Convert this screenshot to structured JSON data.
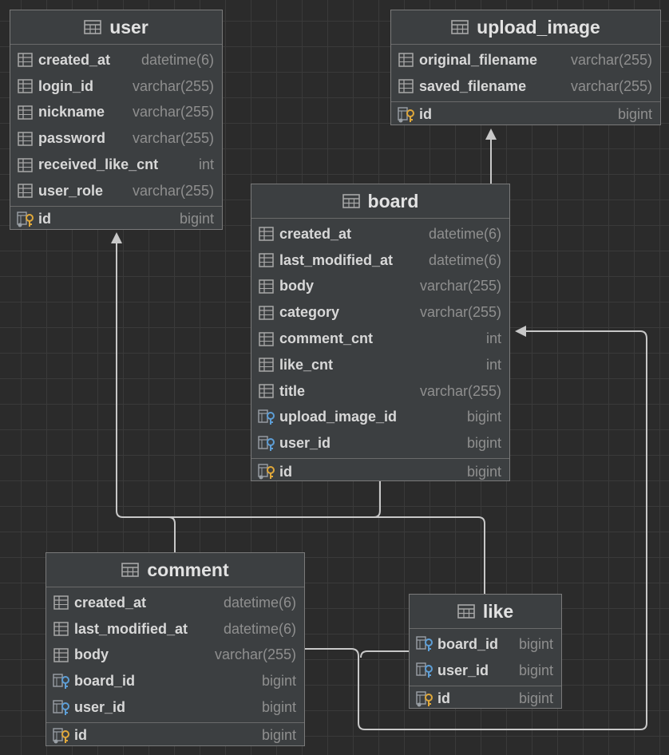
{
  "tables": {
    "user": {
      "name": "user",
      "columns": [
        {
          "name": "created_at",
          "type": "datetime(6)",
          "kind": "column"
        },
        {
          "name": "login_id",
          "type": "varchar(255)",
          "kind": "column"
        },
        {
          "name": "nickname",
          "type": "varchar(255)",
          "kind": "column"
        },
        {
          "name": "password",
          "type": "varchar(255)",
          "kind": "column"
        },
        {
          "name": "received_like_cnt",
          "type": "int",
          "kind": "column"
        },
        {
          "name": "user_role",
          "type": "varchar(255)",
          "kind": "column"
        }
      ],
      "pk": {
        "name": "id",
        "type": "bigint"
      }
    },
    "upload_image": {
      "name": "upload_image",
      "columns": [
        {
          "name": "original_filename",
          "type": "varchar(255)",
          "kind": "column"
        },
        {
          "name": "saved_filename",
          "type": "varchar(255)",
          "kind": "column"
        }
      ],
      "pk": {
        "name": "id",
        "type": "bigint"
      }
    },
    "board": {
      "name": "board",
      "columns": [
        {
          "name": "created_at",
          "type": "datetime(6)",
          "kind": "column"
        },
        {
          "name": "last_modified_at",
          "type": "datetime(6)",
          "kind": "column"
        },
        {
          "name": "body",
          "type": "varchar(255)",
          "kind": "column"
        },
        {
          "name": "category",
          "type": "varchar(255)",
          "kind": "column"
        },
        {
          "name": "comment_cnt",
          "type": "int",
          "kind": "column"
        },
        {
          "name": "like_cnt",
          "type": "int",
          "kind": "column"
        },
        {
          "name": "title",
          "type": "varchar(255)",
          "kind": "column"
        },
        {
          "name": "upload_image_id",
          "type": "bigint",
          "kind": "fk"
        },
        {
          "name": "user_id",
          "type": "bigint",
          "kind": "fk"
        }
      ],
      "pk": {
        "name": "id",
        "type": "bigint"
      }
    },
    "comment": {
      "name": "comment",
      "columns": [
        {
          "name": "created_at",
          "type": "datetime(6)",
          "kind": "column"
        },
        {
          "name": "last_modified_at",
          "type": "datetime(6)",
          "kind": "column"
        },
        {
          "name": "body",
          "type": "varchar(255)",
          "kind": "column"
        },
        {
          "name": "board_id",
          "type": "bigint",
          "kind": "fk"
        },
        {
          "name": "user_id",
          "type": "bigint",
          "kind": "fk"
        }
      ],
      "pk": {
        "name": "id",
        "type": "bigint"
      }
    },
    "like": {
      "name": "like",
      "columns": [
        {
          "name": "board_id",
          "type": "bigint",
          "kind": "fk"
        },
        {
          "name": "user_id",
          "type": "bigint",
          "kind": "fk"
        }
      ],
      "pk": {
        "name": "id",
        "type": "bigint"
      }
    }
  },
  "relations": [
    {
      "from": "board",
      "to": "upload_image"
    },
    {
      "from": "board",
      "to": "user"
    },
    {
      "from": "comment",
      "to": "user"
    },
    {
      "from": "comment",
      "to": "board"
    },
    {
      "from": "like",
      "to": "user"
    },
    {
      "from": "like",
      "to": "board"
    }
  ],
  "colors": {
    "canvas": "#2b2b2b",
    "table_bg": "#3c3f41",
    "edge": "#c8c8c8",
    "fk_key": "#5d9ed6",
    "pk_key": "#e0a83a"
  }
}
